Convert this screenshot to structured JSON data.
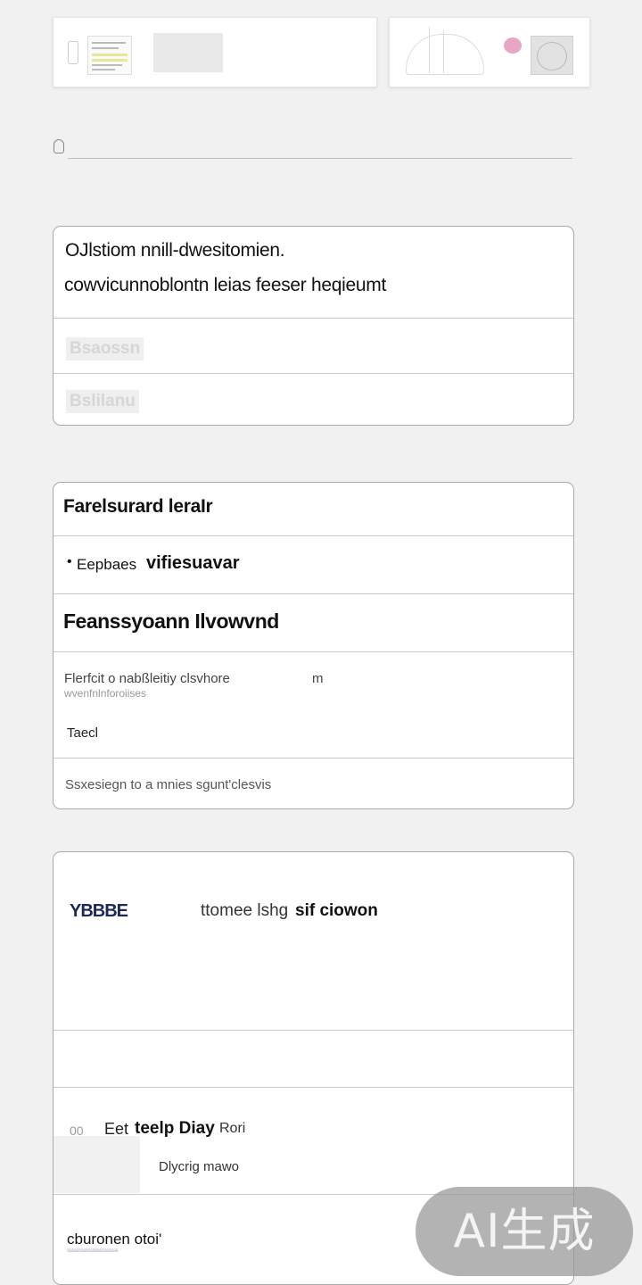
{
  "search": {
    "placeholder": ""
  },
  "panel1": {
    "title_line1": "OJlstiom nnill-dwesitomien.",
    "title_line2": "cowvicunnoblontn leias feeser heqieumt",
    "items": [
      "Bsaossn",
      "Bslilanu"
    ]
  },
  "panel2": {
    "header": "Farelsurard leraIr",
    "bullet": "Eepbaes",
    "bullet_strong": "vifiesuavar",
    "section_title": "Feanssyoann Ilvowvnd",
    "desc_line1": "Flerfcit o nabßleitiy clsvhore",
    "desc_line1_right": "m",
    "desc_line2": "wvenfnlnforoiises",
    "label": "Taecl",
    "footer": "Ssxesiegn to a mnies sgunt'clesvis"
  },
  "panel3": {
    "code": "YBBBE",
    "heading": "ttomee lshg",
    "heading_strong": "sif ciowon",
    "list_icon_text": "00",
    "item_title_a": "Eet",
    "item_title_b": "teelp Diay",
    "item_title_c": "Rori",
    "item_sub": "Dlycrig mawo",
    "bottom_label": "cburonen otoi'",
    "bottom_sub": "ssssssssssssssssssssss"
  },
  "watermark": "AI生成"
}
